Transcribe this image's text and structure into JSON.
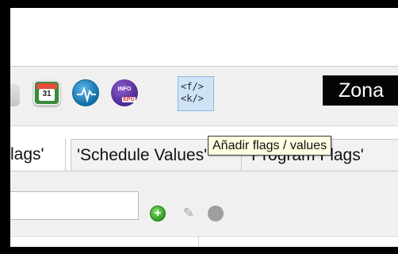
{
  "toolbar": {
    "calendar_day": "31",
    "info_icon_text": "INFO",
    "epg_icon_text": "EPG",
    "flags_button_line1": "<f/>",
    "flags_button_line2": "<k/>",
    "zona_label": "Zona"
  },
  "tabs": [
    {
      "label": "lags'"
    },
    {
      "label": "'Schedule Values'"
    },
    {
      "label": "'Program Flags'"
    }
  ],
  "tooltip": {
    "text": "Añadir flags / values"
  },
  "filter": {
    "value": "",
    "placeholder": ""
  },
  "icons": {
    "calendar": "calendar-icon",
    "pulse": "heartbeat-icon",
    "info": "info-epg-icon",
    "flags": "flags-values-icon",
    "add": "add-icon",
    "edit": "pencil-icon",
    "delete": "delete-icon"
  },
  "colors": {
    "tooltip_bg": "#ffffe1",
    "badge_bg": "#050505",
    "flags_button_bg": "#cfe3f7"
  }
}
